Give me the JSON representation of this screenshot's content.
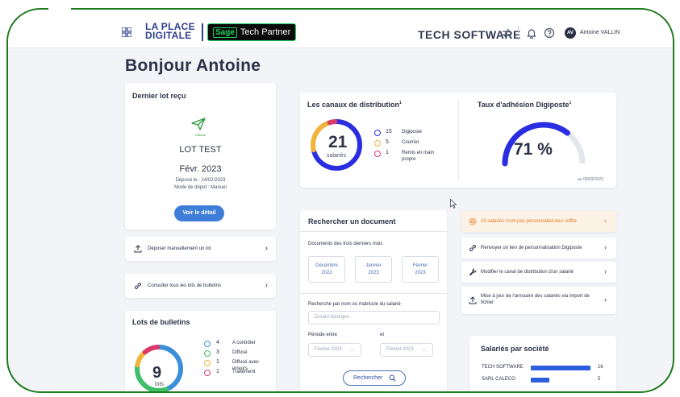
{
  "header": {
    "logo_line1": "LA PLACE",
    "logo_line2": "DIGITALE",
    "partner_brand": "Sage",
    "partner_label": "Tech Partner",
    "company_name": "TECH SOFTWARE",
    "avatar_initials": "AV",
    "user_name": "Antoine VALLIN",
    "icons": [
      "grid-icon",
      "switch-icon",
      "bell-icon",
      "help-icon"
    ]
  },
  "greeting": "Bonjour Antoine",
  "last_batch": {
    "title": "Dernier lot reçu",
    "status": "Diffusé",
    "name": "LOT TEST",
    "period": "Févr. 2023",
    "deposit_date": "Déposé le : 24/02/2023",
    "deposit_mode": "Mode de dépot : Manuel",
    "detail_button": "Voir le détail",
    "accent": "#3f7ed8",
    "status_color": "#2a9a3a"
  },
  "quick_actions": [
    {
      "icon": "upload-icon",
      "label": "Déposer manuellement un lot"
    },
    {
      "icon": "link-icon",
      "label": "Consulter tous les lots de bulletins"
    }
  ],
  "distribution": {
    "title": "Les canaux de distribution",
    "superscript": "1",
    "total": "21",
    "total_label": "salariés",
    "legend": [
      {
        "count": "15",
        "label": "Digiposte",
        "color": "#2a2ee0"
      },
      {
        "count": "5",
        "label": "Courrier",
        "color": "#f0b43a"
      },
      {
        "count": "1",
        "label": "Remis en main propre",
        "color": "#d93a6a"
      }
    ]
  },
  "adhesion": {
    "title": "Taux d'adhésion Digiposte",
    "superscript": "1",
    "value": "71 %",
    "percent": 71,
    "date_note": "au 06/03/2023",
    "color": "#2a2ee0"
  },
  "search": {
    "title": "Rechercher un document",
    "recent_label": "Documents des trois derniers mois",
    "months": [
      {
        "month": "Décembre",
        "year": "2022"
      },
      {
        "month": "Janvier",
        "year": "2023"
      },
      {
        "month": "Février",
        "year": "2023"
      }
    ],
    "name_label": "Recherche par nom ou matricule du salarié",
    "name_placeholder": "Durant Georges",
    "period_label": "Période entre",
    "and_label": "et",
    "from_value": "Février 2023",
    "to_value": "Février 2023",
    "search_button": "Rechercher"
  },
  "right_actions": [
    {
      "icon": "gear-icon",
      "label": "15 salariés n'ont pas personnalisé leur coffre",
      "highlight": true
    },
    {
      "icon": "link-icon",
      "label": "Renvoyer un lien de personnalisation Digiposte",
      "highlight": false
    },
    {
      "icon": "wrench-icon",
      "label": "Modifier le canal de distribution d'un salarié",
      "highlight": false
    },
    {
      "icon": "upload-icon",
      "label": "Mise à jour de l'annuaire des salariés via import de fichier",
      "highlight": false
    }
  ],
  "batches": {
    "title": "Lots de bulletins",
    "total": "9",
    "total_label": "lots",
    "legend": [
      {
        "count": "4",
        "label": "A contrôler",
        "color": "#3b8fd8"
      },
      {
        "count": "3",
        "label": "Diffusé",
        "color": "#3fbf6a"
      },
      {
        "count": "1",
        "label": "Diffusé avec erreurs",
        "color": "#f0b43a"
      },
      {
        "count": "1",
        "label": "Traitement",
        "color": "#d93a6a"
      }
    ]
  },
  "by_company": {
    "title": "Salariés par société",
    "rows": [
      {
        "name": "TECH SOFTWARE",
        "value": 16
      },
      {
        "name": "SARL CALECO",
        "value": 5
      }
    ],
    "max": 16
  }
}
